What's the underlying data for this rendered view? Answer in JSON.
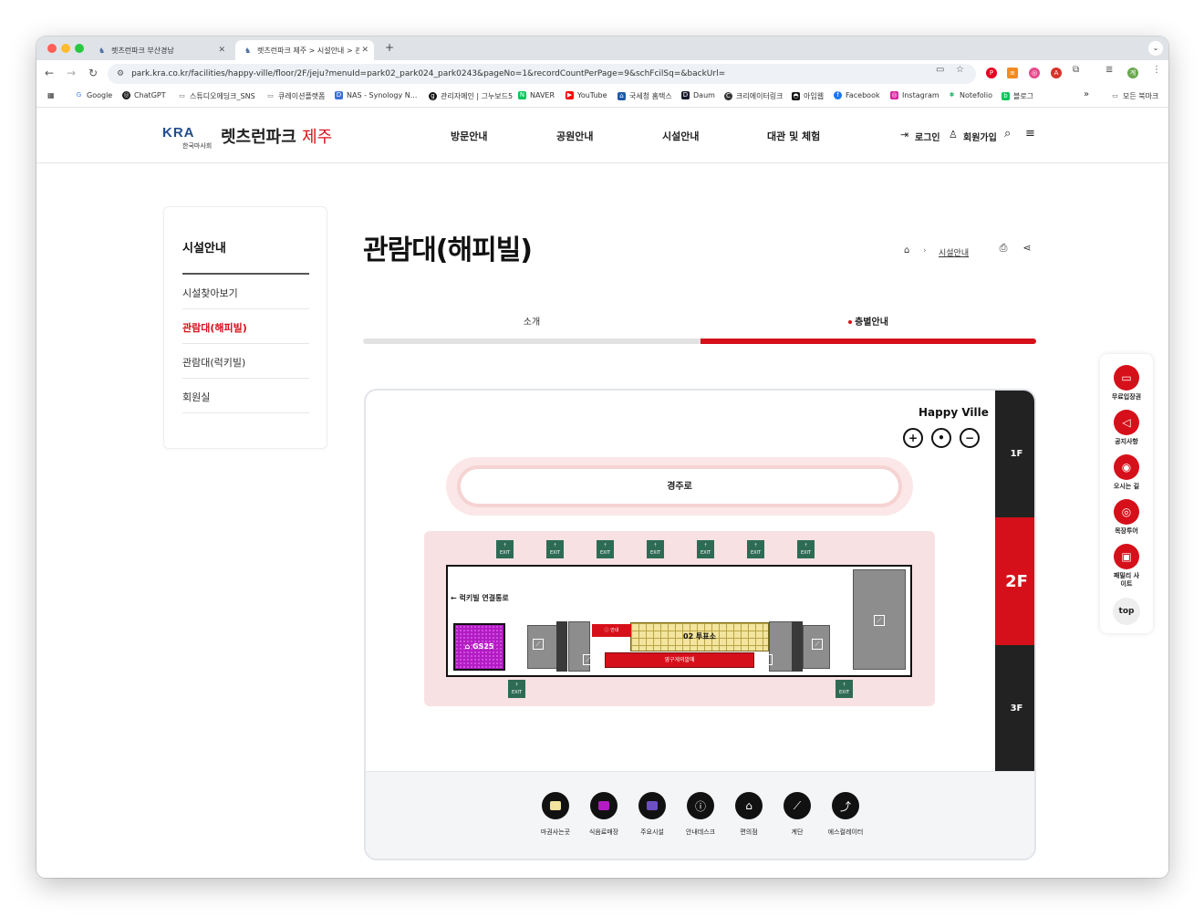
{
  "browser": {
    "tabs": [
      {
        "title": "렛츠런파크 부산경남"
      },
      {
        "title": "렛츠런파크 제주 > 시설안내 > 관람"
      }
    ],
    "new_tab": "+",
    "url": "park.kra.co.kr/facilities/happy-ville/floor/2F/jeju?menuId=park02_park024_park0243&pageNo=1&recordCountPerPage=9&schFcilSq=&backUrl=",
    "bookmarks": [
      "Google",
      "ChatGPT",
      "스튜디오에딩크_SNS",
      "큐레이션플랫폼",
      "NAS - Synology N...",
      "관리자메인 | 그누보드5",
      "NAVER",
      "YouTube",
      "국세청 홈택스",
      "Daum",
      "크리에이터링크",
      "아임웹",
      "Facebook",
      "Instagram",
      "Notefolio",
      "블로그"
    ],
    "bookmarks_more": "»",
    "all_bookmarks": "모든 북마크"
  },
  "header": {
    "logo_kra": "KRA",
    "logo_sub": "한국마사회",
    "logo_name": "렛츠런파크",
    "logo_region": "제주",
    "nav": [
      "방문안내",
      "공원안내",
      "시설안내",
      "대관 및 체험"
    ],
    "login": "로그인",
    "signup": "회원가입"
  },
  "sidebar": {
    "title": "시설안내",
    "items": [
      {
        "label": "시설찾아보기",
        "active": false
      },
      {
        "label": "관람대(해피빌)",
        "active": true
      },
      {
        "label": "관람대(럭키빌)",
        "active": false
      },
      {
        "label": "회원실",
        "active": false
      }
    ]
  },
  "content": {
    "title": "관람대(해피빌)",
    "breadcrumb": "시설안내",
    "tabs": [
      "소개",
      "층별안내"
    ]
  },
  "map": {
    "building_name": "Happy Ville",
    "zoom": [
      "+",
      "•",
      "−"
    ],
    "track_label": "경주로",
    "connection_label": "← 럭키빌 연결통로",
    "gs25": "GS25",
    "info_desk": "안내",
    "ticket_area": "02 투표소",
    "machines_label": "영구게의발매",
    "exit_label": "EXIT",
    "floors": [
      {
        "label": "1F",
        "active": false
      },
      {
        "label": "2F",
        "active": true
      },
      {
        "label": "3F",
        "active": false
      }
    ],
    "legend": [
      "마권사는곳",
      "식음료매장",
      "주요시설",
      "안내데스크",
      "편의점",
      "계단",
      "에스컬레이터"
    ]
  },
  "quick_menu": {
    "items": [
      "무료입장권",
      "공지사항",
      "오시는 길",
      "목장투어",
      "패밀리 사이트"
    ],
    "top": "top"
  },
  "colors": {
    "accent": "#d6101a",
    "dark": "#222222",
    "exit": "#2e6b55",
    "gs25": "#b31bc4",
    "ticket": "#f3e49e"
  }
}
